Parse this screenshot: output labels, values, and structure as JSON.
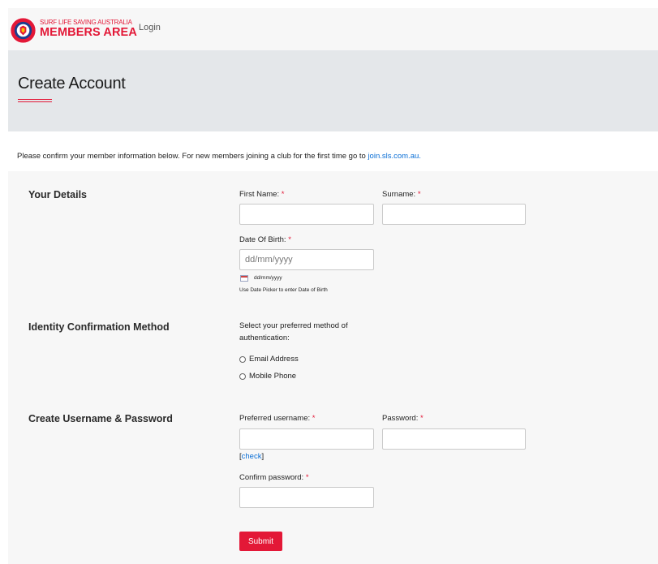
{
  "header": {
    "logo_small": "SURF LIFE SAVING AUSTRALIA",
    "logo_big": "MEMBERS AREA",
    "login_label": "Login",
    "brand_color": "#e31837"
  },
  "page": {
    "title": "Create Account"
  },
  "intro": {
    "text": "Please confirm your member information below. For new members joining a club for the first time go to ",
    "link_text": "join.sls.com.au."
  },
  "form": {
    "your_details": {
      "section_title": "Your Details",
      "first_name_label": "First Name:",
      "surname_label": "Surname:",
      "dob_label": "Date Of Birth:",
      "dob_placeholder": "dd/mm/yyyy",
      "dob_format_hint": "dd/mm/yyyy",
      "dob_help": "Use Date Picker to enter Date of Birth",
      "required_mark": "*"
    },
    "identity": {
      "section_title": "Identity Confirmation Method",
      "prompt_line1": "Select your preferred method of",
      "prompt_line2": "authentication:",
      "option_email": "Email Address",
      "option_mobile": "Mobile Phone"
    },
    "credentials": {
      "section_title": "Create Username & Password",
      "username_label": "Preferred username:",
      "password_label": "Password:",
      "check_link": "check",
      "confirm_label": "Confirm password:"
    },
    "submit_label": "Submit"
  }
}
